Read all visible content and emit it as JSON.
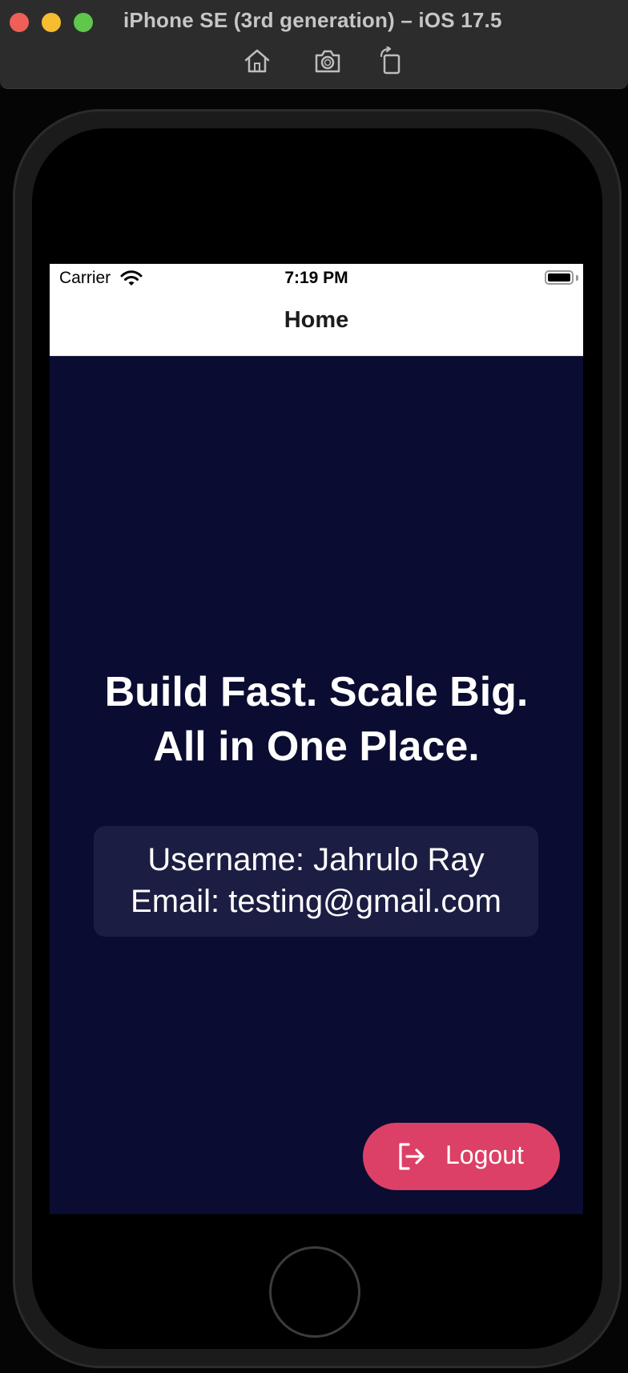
{
  "window": {
    "title": "iPhone SE (3rd generation) – iOS 17.5",
    "toolbar": [
      "home-icon",
      "screenshot-icon",
      "rotate-icon"
    ]
  },
  "status_bar": {
    "carrier": "Carrier",
    "time": "7:19 PM"
  },
  "nav": {
    "title": "Home"
  },
  "headline": {
    "line1": "Build Fast. Scale Big.",
    "line2": "All in One Place."
  },
  "profile": {
    "username": "Username: Jahrulo Ray",
    "email": "Email: testing@gmail.com"
  },
  "logout": {
    "label": "Logout",
    "icon": "logout-icon"
  },
  "colors": {
    "screen_background": "#0b0c31",
    "card_background": "#1c1d42",
    "logout_accent": "#dc4066"
  }
}
